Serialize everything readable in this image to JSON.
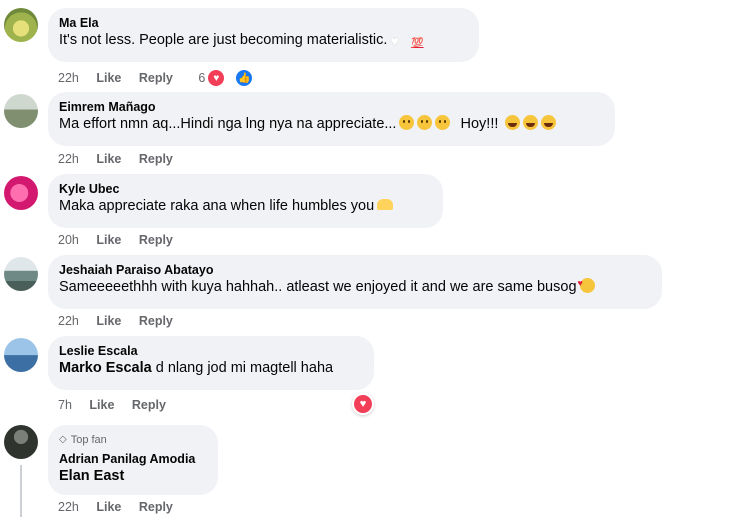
{
  "comments": [
    {
      "author": "Ma Ela",
      "text": "It's not less. People are just becoming materialistic.",
      "emojis": [
        "white-heart-emoji",
        "hundred-points-emoji"
      ],
      "time": "22h",
      "like_label": "Like",
      "reply_label": "Reply",
      "reaction_count": "6",
      "reaction_icons": [
        "love",
        "like"
      ],
      "avatar_color": "#b8c65a"
    },
    {
      "author": "Eimrem Mañago",
      "text": "Ma effort nmn aq...Hindi nga lng nya na appreciate...",
      "text_tail": "Hoy!!!",
      "emojis": [
        "sad-face-emoji",
        "sad-face-emoji",
        "sad-face-emoji",
        "laughing-emoji",
        "laughing-emoji",
        "laughing-emoji"
      ],
      "time": "22h",
      "like_label": "Like",
      "reply_label": "Reply",
      "avatar_color": "#9aa89a"
    },
    {
      "author": "Kyle Ubec",
      "text": "Maka appreciate raka ana when life humbles you",
      "emojis": [
        "heart-hands-emoji"
      ],
      "time": "20h",
      "like_label": "Like",
      "reply_label": "Reply",
      "avatar_color": "#e83e8c"
    },
    {
      "author": "Jeshaiah Paraiso Abatayo",
      "text": "Sameeeeethhh with kuya hahhah.. atleast we enjoyed it and we are same busog",
      "emojis": [
        "smiling-face-with-hearts-emoji"
      ],
      "time": "22h",
      "like_label": "Like",
      "reply_label": "Reply",
      "avatar_color": "#8fa3a8"
    },
    {
      "author": "Leslie Escala",
      "mention": "Marko Escala",
      "text": " d nlang jod mi magtell haha",
      "time": "7h",
      "like_label": "Like",
      "reply_label": "Reply",
      "floating_reaction": "love",
      "avatar_color": "#5b8fc4"
    },
    {
      "badge": "Top fan",
      "author": "Adrian Panilag Amodia",
      "mention": "Elan East",
      "text": "",
      "time": "22h",
      "like_label": "Like",
      "reply_label": "Reply",
      "avatar_color": "#3a3f3a"
    }
  ]
}
